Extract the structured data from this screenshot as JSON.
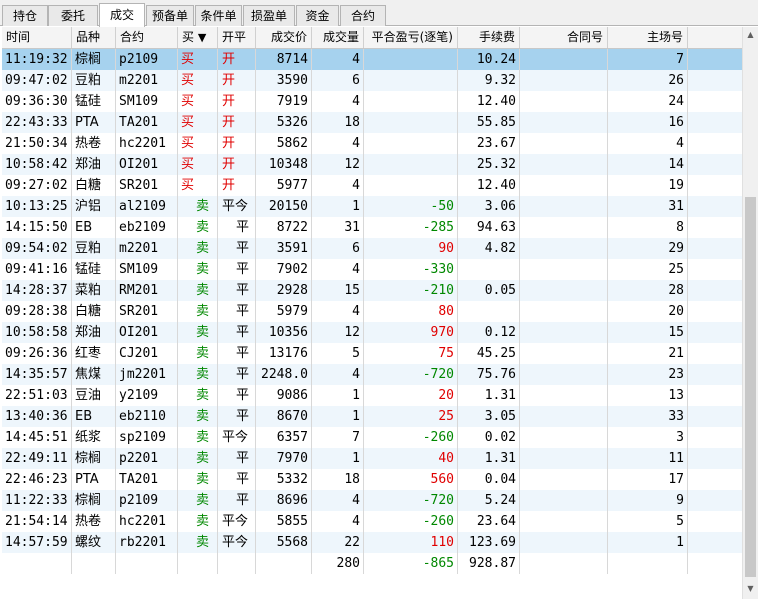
{
  "tabs": [
    {
      "label": "持仓"
    },
    {
      "label": "委托"
    },
    {
      "label": "成交",
      "active": true
    },
    {
      "label": "预备单"
    },
    {
      "label": "条件单"
    },
    {
      "label": "损盈单"
    },
    {
      "label": "资金"
    },
    {
      "label": "合约"
    }
  ],
  "columns": [
    "时间",
    "品种",
    "合约",
    "买卖",
    "开平",
    "成交价",
    "成交量",
    "平合盈亏(逐笔)",
    "手续费",
    "合同号",
    "主场号"
  ],
  "sort_indicator": "▼",
  "rows": [
    {
      "time": "11:19:32",
      "variety": "棕榈",
      "contract": "p2109",
      "side": "买",
      "oc": "开",
      "price": "8714",
      "qty": "4",
      "pnl": "",
      "fee": "10.24",
      "order": "",
      "seat": "7",
      "selected": true
    },
    {
      "time": "09:47:02",
      "variety": "豆粕",
      "contract": "m2201",
      "side": "买",
      "oc": "开",
      "price": "3590",
      "qty": "6",
      "pnl": "",
      "fee": "9.32",
      "order": "",
      "seat": "26"
    },
    {
      "time": "09:36:30",
      "variety": "锰硅",
      "contract": "SM109",
      "side": "买",
      "oc": "开",
      "price": "7919",
      "qty": "4",
      "pnl": "",
      "fee": "12.40",
      "order": "",
      "seat": "24"
    },
    {
      "time": "22:43:33",
      "variety": "PTA",
      "contract": "TA201",
      "side": "买",
      "oc": "开",
      "price": "5326",
      "qty": "18",
      "pnl": "",
      "fee": "55.85",
      "order": "",
      "seat": "16"
    },
    {
      "time": "21:50:34",
      "variety": "热卷",
      "contract": "hc2201",
      "side": "买",
      "oc": "开",
      "price": "5862",
      "qty": "4",
      "pnl": "",
      "fee": "23.67",
      "order": "",
      "seat": "4"
    },
    {
      "time": "10:58:42",
      "variety": "郑油",
      "contract": "OI201",
      "side": "买",
      "oc": "开",
      "price": "10348",
      "qty": "12",
      "pnl": "",
      "fee": "25.32",
      "order": "",
      "seat": "14"
    },
    {
      "time": "09:27:02",
      "variety": "白糖",
      "contract": "SR201",
      "side": "买",
      "oc": "开",
      "price": "5977",
      "qty": "4",
      "pnl": "",
      "fee": "12.40",
      "order": "",
      "seat": "19"
    },
    {
      "time": "10:13:25",
      "variety": "沪铝",
      "contract": "al2109",
      "side": "卖",
      "oc": "平今",
      "price": "20150",
      "qty": "1",
      "pnl": "-50",
      "fee": "3.06",
      "order": "",
      "seat": "31"
    },
    {
      "time": "14:15:50",
      "variety": "EB",
      "contract": "eb2109",
      "side": "卖",
      "oc": "平",
      "price": "8722",
      "qty": "31",
      "pnl": "-285",
      "fee": "94.63",
      "order": "",
      "seat": "8"
    },
    {
      "time": "09:54:02",
      "variety": "豆粕",
      "contract": "m2201",
      "side": "卖",
      "oc": "平",
      "price": "3591",
      "qty": "6",
      "pnl": "90",
      "fee": "4.82",
      "order": "",
      "seat": "29"
    },
    {
      "time": "09:41:16",
      "variety": "锰硅",
      "contract": "SM109",
      "side": "卖",
      "oc": "平",
      "price": "7902",
      "qty": "4",
      "pnl": "-330",
      "fee": "",
      "order": "",
      "seat": "25"
    },
    {
      "time": "14:28:37",
      "variety": "菜粕",
      "contract": "RM201",
      "side": "卖",
      "oc": "平",
      "price": "2928",
      "qty": "15",
      "pnl": "-210",
      "fee": "0.05",
      "order": "",
      "seat": "28"
    },
    {
      "time": "09:28:38",
      "variety": "白糖",
      "contract": "SR201",
      "side": "卖",
      "oc": "平",
      "price": "5979",
      "qty": "4",
      "pnl": "80",
      "fee": "",
      "order": "",
      "seat": "20"
    },
    {
      "time": "10:58:58",
      "variety": "郑油",
      "contract": "OI201",
      "side": "卖",
      "oc": "平",
      "price": "10356",
      "qty": "12",
      "pnl": "970",
      "fee": "0.12",
      "order": "",
      "seat": "15"
    },
    {
      "time": "09:26:36",
      "variety": "红枣",
      "contract": "CJ201",
      "side": "卖",
      "oc": "平",
      "price": "13176",
      "qty": "5",
      "pnl": "75",
      "fee": "45.25",
      "order": "",
      "seat": "21"
    },
    {
      "time": "14:35:57",
      "variety": "焦煤",
      "contract": "jm2201",
      "side": "卖",
      "oc": "平",
      "price": "2248.0",
      "qty": "4",
      "pnl": "-720",
      "fee": "75.76",
      "order": "",
      "seat": "23"
    },
    {
      "time": "22:51:03",
      "variety": "豆油",
      "contract": "y2109",
      "side": "卖",
      "oc": "平",
      "price": "9086",
      "qty": "1",
      "pnl": "20",
      "fee": "1.31",
      "order": "",
      "seat": "13"
    },
    {
      "time": "13:40:36",
      "variety": "EB",
      "contract": "eb2110",
      "side": "卖",
      "oc": "平",
      "price": "8670",
      "qty": "1",
      "pnl": "25",
      "fee": "3.05",
      "order": "",
      "seat": "33"
    },
    {
      "time": "14:45:51",
      "variety": "纸浆",
      "contract": "sp2109",
      "side": "卖",
      "oc": "平今",
      "price": "6357",
      "qty": "7",
      "pnl": "-260",
      "fee": "0.02",
      "order": "",
      "seat": "3"
    },
    {
      "time": "22:49:11",
      "variety": "棕榈",
      "contract": "p2201",
      "side": "卖",
      "oc": "平",
      "price": "7970",
      "qty": "1",
      "pnl": "40",
      "fee": "1.31",
      "order": "",
      "seat": "11"
    },
    {
      "time": "22:46:23",
      "variety": "PTA",
      "contract": "TA201",
      "side": "卖",
      "oc": "平",
      "price": "5332",
      "qty": "18",
      "pnl": "560",
      "fee": "0.04",
      "order": "",
      "seat": "17"
    },
    {
      "time": "11:22:33",
      "variety": "棕榈",
      "contract": "p2109",
      "side": "卖",
      "oc": "平",
      "price": "8696",
      "qty": "4",
      "pnl": "-720",
      "fee": "5.24",
      "order": "",
      "seat": "9"
    },
    {
      "time": "21:54:14",
      "variety": "热卷",
      "contract": "hc2201",
      "side": "卖",
      "oc": "平今",
      "price": "5855",
      "qty": "4",
      "pnl": "-260",
      "fee": "23.64",
      "order": "",
      "seat": "5"
    },
    {
      "time": "14:57:59",
      "variety": "螺纹",
      "contract": "rb2201",
      "side": "卖",
      "oc": "平今",
      "price": "5568",
      "qty": "22",
      "pnl": "110",
      "fee": "123.69",
      "order": "",
      "seat": "1"
    }
  ],
  "totals": {
    "qty": "280",
    "pnl": "-865",
    "fee": "928.87"
  },
  "colors": {
    "buy": "#e00000",
    "sell": "#008800",
    "profit": "#e00000",
    "loss": "#008800",
    "selected_row": "#a6d2ee",
    "row_odd": "#ffffff",
    "row_even": "#eef6fc"
  },
  "scrollbar": {
    "up_icon": "▲",
    "down_icon": "▼"
  }
}
